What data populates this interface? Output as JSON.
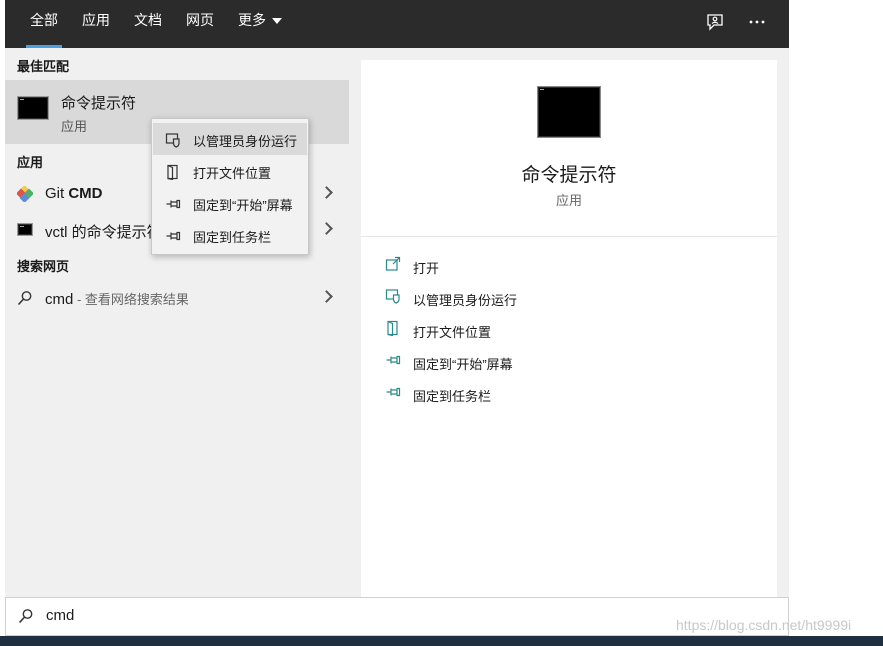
{
  "tabs": [
    {
      "label": "全部",
      "active": true
    },
    {
      "label": "应用"
    },
    {
      "label": "文档"
    },
    {
      "label": "网页"
    },
    {
      "label": "更多"
    }
  ],
  "header_icons": [
    "feedback-icon",
    "more-options-icon"
  ],
  "sections": {
    "best_match": "最佳匹配",
    "apps": "应用",
    "web": "搜索网页"
  },
  "best_match": {
    "title": "命令提示符",
    "subtitle": "应用"
  },
  "apps": [
    {
      "name_plain": "Git ",
      "name_bold": "CMD"
    },
    {
      "name_plain": "vctl 的命令提示符"
    }
  ],
  "web_result": {
    "query": "cmd",
    "suffix": " - 查看网络搜索结果"
  },
  "context_menu": [
    {
      "label": "以管理员身份运行",
      "icon": "shield-icon",
      "highlighted": true
    },
    {
      "label": "打开文件位置",
      "icon": "folder-location-icon"
    },
    {
      "label": "固定到“开始”屏幕",
      "icon": "pin-icon"
    },
    {
      "label": "固定到任务栏",
      "icon": "pin-icon"
    }
  ],
  "details": {
    "title": "命令提示符",
    "subtitle": "应用"
  },
  "actions": [
    {
      "label": "打开",
      "icon": "open-icon"
    },
    {
      "label": "以管理员身份运行",
      "icon": "shield-icon"
    },
    {
      "label": "打开文件位置",
      "icon": "folder-location-icon"
    },
    {
      "label": "固定到“开始”屏幕",
      "icon": "pin-icon"
    },
    {
      "label": "固定到任务栏",
      "icon": "pin-icon"
    }
  ],
  "search": {
    "value": "cmd"
  },
  "watermark": "https://blog.csdn.net/ht9999i",
  "colors": {
    "accent": "#4a9fe0",
    "action_icon": "#2a8a8a",
    "topbar": "#2b2b2b"
  }
}
